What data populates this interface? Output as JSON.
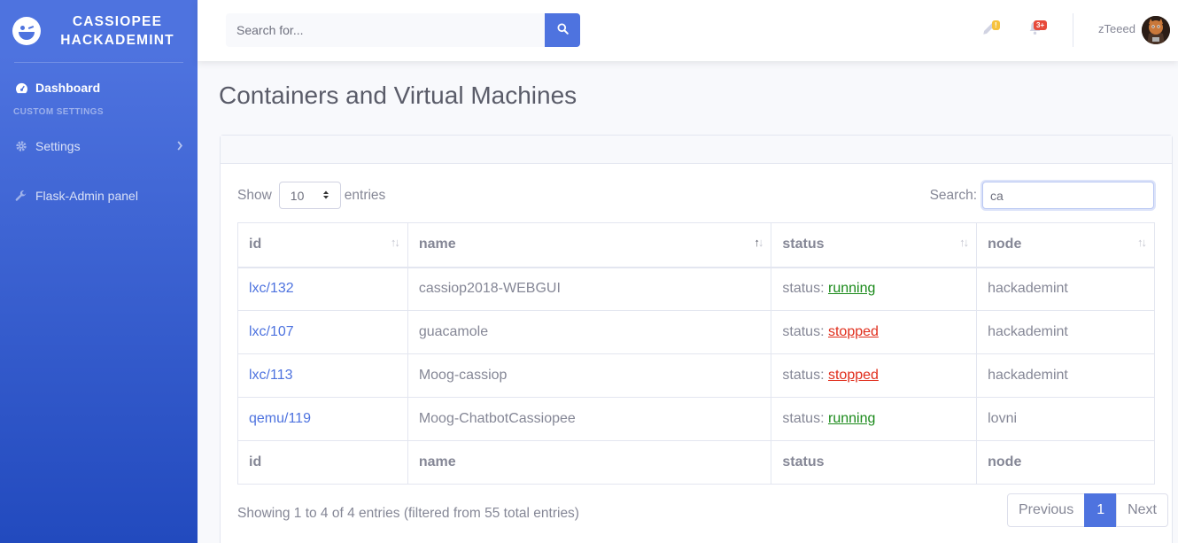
{
  "brand": {
    "line1": "CASSIOPEE",
    "line2": "HACKADEMINT",
    "icon": "laugh-wink-icon"
  },
  "sidebar": {
    "items": [
      {
        "label": "Dashboard",
        "icon": "tachometer-icon",
        "active": true
      },
      {
        "heading": "CUSTOM SETTINGS"
      },
      {
        "label": "Settings",
        "icon": "cog-icon",
        "chevron": "chevron-right-icon"
      },
      {
        "label": "Flask-Admin panel",
        "icon": "wrench-icon"
      }
    ]
  },
  "topbar": {
    "search_placeholder": "Search for...",
    "pencil_badge": "!",
    "bell_badge": "3+",
    "username": "zTeeed"
  },
  "page": {
    "title": "Containers and Virtual Machines"
  },
  "datatable": {
    "show_label": "Show",
    "entries_label": "entries",
    "length_value": "10",
    "search_label": "Search:",
    "search_value": "ca",
    "columns": [
      "id",
      "name",
      "status",
      "node"
    ],
    "status_prefix": "status:",
    "rows": [
      {
        "id": "lxc/132",
        "name": "cassiop2018-WEBGUI",
        "status": "running",
        "node": "hackademint"
      },
      {
        "id": "lxc/107",
        "name": "guacamole",
        "status": "stopped",
        "node": "hackademint"
      },
      {
        "id": "lxc/113",
        "name": "Moog-cassiop",
        "status": "stopped",
        "node": "hackademint"
      },
      {
        "id": "qemu/119",
        "name": "Moog-ChatbotCassiopee",
        "status": "running",
        "node": "lovni"
      }
    ],
    "info": "Showing 1 to 4 of 4 entries (filtered from 55 total entries)",
    "pagination": {
      "previous": "Previous",
      "current": "1",
      "next": "Next"
    }
  },
  "colors": {
    "primary": "#4e73df",
    "running": "#1a8a1a",
    "stopped": "#e02d1b"
  }
}
